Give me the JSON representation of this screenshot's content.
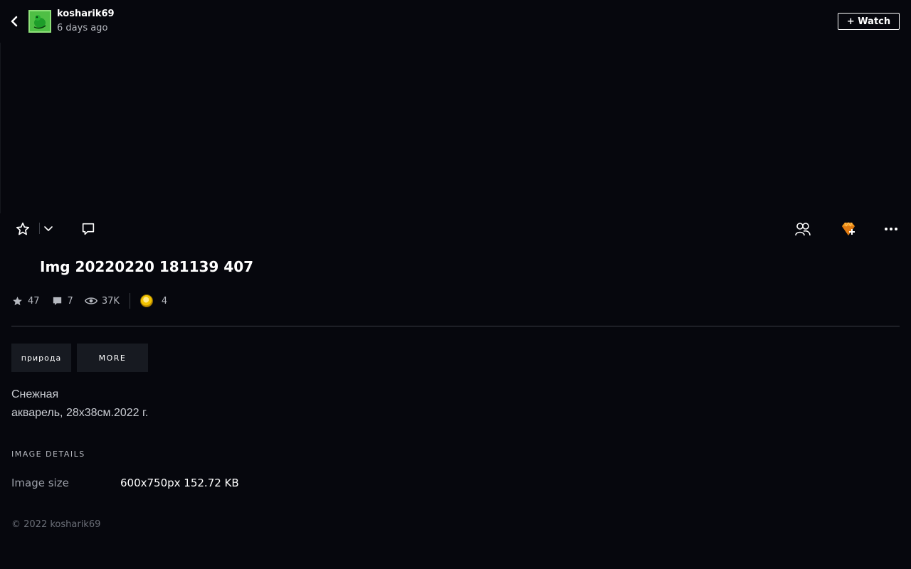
{
  "header": {
    "username": "kosharik69",
    "time_ago": "6 days ago",
    "watch_label": "+ Watch"
  },
  "deviation": {
    "title": "Img 20220220 181139 407",
    "stats": {
      "favourites": "47",
      "comments": "7",
      "views": "37K",
      "coins": "4"
    },
    "tags": [
      "природа"
    ],
    "more_label": "MORE",
    "description": [
      "Снежная",
      "акварель, 28х38см.2022 г."
    ]
  },
  "image_details": {
    "heading": "IMAGE DETAILS",
    "size_label": "Image size",
    "size_value": "600x750px 152.72 KB"
  },
  "footer": {
    "copyright": "© 2022 kosharik69"
  },
  "icons": {
    "back": "chevron-left-icon",
    "favourite": "star-icon",
    "dropdown": "chevron-down-icon",
    "comment": "comment-icon",
    "group": "group-icon",
    "gift": "gem-icon",
    "more": "ellipsis-icon",
    "eye": "eye-icon",
    "coin": "coin-icon"
  },
  "colors": {
    "background": "#06070d",
    "tag_background": "#171a21",
    "gem_accent": "#f59a1b",
    "text_muted": "#b5b8bf"
  }
}
